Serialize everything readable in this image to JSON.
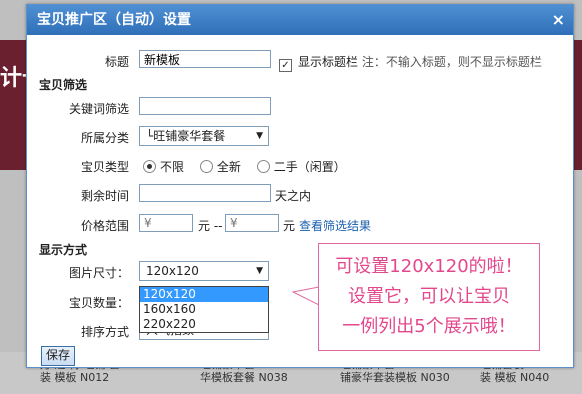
{
  "background": {
    "left_text": "计十",
    "bottom_items": [
      {
        "line1": "万 迪 特 旺铺 套 ",
        "line2": "装 模板 N012"
      },
      {
        "line1": "旺铺豪华套",
        "line2": "华模板套餐 N038"
      },
      {
        "line1": "旺铺豪华套",
        "line2": "铺豪华套装模板 N030"
      },
      {
        "line1": "旺铺套装",
        "line2": "装 模板 N040"
      }
    ]
  },
  "dialog": {
    "title": "宝贝推广区（自动）设置",
    "close_label": "×",
    "title_label": "标题",
    "title_value": "新模板",
    "show_title_label": "显示标题栏",
    "show_title_checked": true,
    "show_title_note": "注：不输入标题，则不显示标题栏",
    "section_filter": "宝贝筛选",
    "keyword_label": "关键词筛选",
    "keyword_value": "",
    "category_label": "所属分类",
    "category_value": "└旺铺豪华套餐",
    "type_label": "宝贝类型",
    "type_options": [
      "不限",
      "全新",
      "二手（闲置）"
    ],
    "type_selected": "不限",
    "time_label": "剩余时间",
    "time_value": "",
    "time_unit": "天之内",
    "price_label": "价格范围",
    "price_min_placeholder": "¥",
    "price_max_placeholder": "¥",
    "price_unit_1": "元 --",
    "price_unit_2": "元",
    "view_results_link": "查看筛选结果",
    "section_display": "显示方式",
    "img_size_label": "图片尺寸：",
    "img_size_value": "120x120",
    "img_size_options": [
      "120x120",
      "160x160",
      "220x220"
    ],
    "count_label": "宝贝数量：",
    "sort_label": "排序方式",
    "sort_value": "人气指数",
    "save_label": "保存"
  },
  "callout": {
    "line1": "可设置120x120的啦！",
    "line2": "设置它，可以让宝贝",
    "line3": "一例列出5个展示哦！",
    "color": "#e3488c"
  }
}
